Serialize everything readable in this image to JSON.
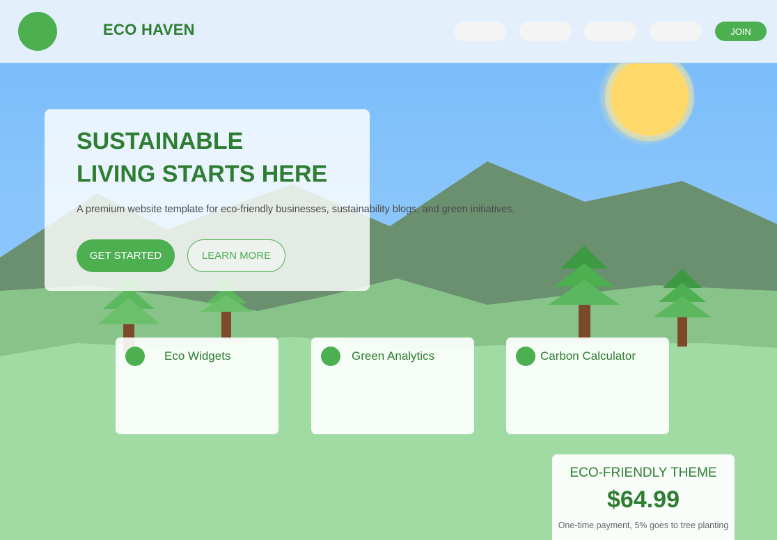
{
  "header": {
    "brand": "ECO HAVEN",
    "join_label": "JOIN"
  },
  "hero": {
    "title_line1": "SUSTAINABLE",
    "title_line2": "LIVING STARTS HERE",
    "description": "A premium website template for eco-friendly businesses, sustainability blogs, and green initiatives.",
    "primary_label": "GET STARTED",
    "secondary_label": "LEARN MORE"
  },
  "features": [
    {
      "title": "Eco Widgets"
    },
    {
      "title": "Green Analytics"
    },
    {
      "title": "Carbon Calculator"
    }
  ],
  "pricing": {
    "name": "ECO-FRIENDLY THEME",
    "price": "$64.99",
    "note": "One-time payment, 5% goes to tree planting"
  },
  "colors": {
    "brand_green": "#4caf50",
    "dark_green": "#2e7d32",
    "sky": "#74b9fb",
    "sun": "#ffd86a"
  }
}
